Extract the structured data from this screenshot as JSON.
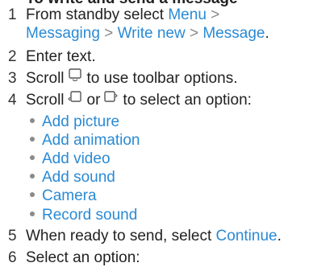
{
  "heading": "To write and send a message",
  "steps": {
    "s1": {
      "number": "1",
      "prefix": "From standby select",
      "menu": "Menu",
      "sep1": ">",
      "messaging": "Messaging",
      "sep2": ">",
      "write_new": "Write new",
      "sep3": ">",
      "message": "Message",
      "end": "."
    },
    "s2": {
      "number": "2",
      "text": "Enter text."
    },
    "s3": {
      "number": "3",
      "before": "Scroll",
      "icon": "scroll-down-icon",
      "after": "to use toolbar options."
    },
    "s4": {
      "number": "4",
      "before": "Scroll",
      "icon_left": "scroll-left-icon",
      "or": "or",
      "icon_right": "scroll-right-icon",
      "after": "to select an option:"
    },
    "s5": {
      "number": "5",
      "text": "When ready to send, select",
      "continue": "Continue",
      "end": "."
    },
    "s6": {
      "number": "6",
      "text": "Select an option:"
    }
  },
  "options": [
    "Add picture",
    "Add animation",
    "Add video",
    "Add sound",
    "Camera",
    "Record sound"
  ],
  "colors": {
    "link": "#2a8ad4",
    "text": "#222222",
    "bullet": "#8a8a8a"
  }
}
